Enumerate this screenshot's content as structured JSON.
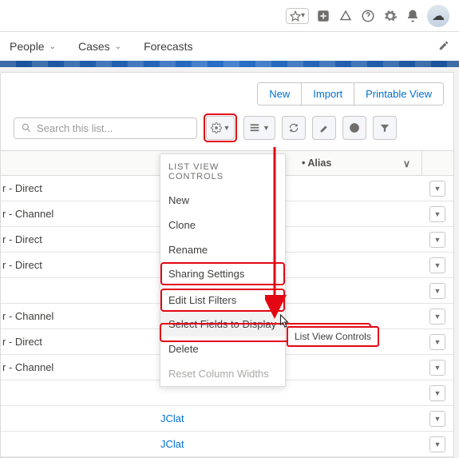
{
  "topbar": {
    "star_caret": "▾",
    "avatar": "☁"
  },
  "nav": {
    "people": "People",
    "cases": "Cases",
    "forecasts": "Forecasts"
  },
  "buttons": {
    "new": "New",
    "import": "Import",
    "printable": "Printable View"
  },
  "search": {
    "placeholder": "Search this list..."
  },
  "table": {
    "alias_header": "Alias",
    "chev": "∨"
  },
  "rows": [
    {
      "title": "r - Direct",
      "alias": ""
    },
    {
      "title": "r - Channel",
      "alias": ""
    },
    {
      "title": "r - Direct",
      "alias": ""
    },
    {
      "title": "r - Direct",
      "alias": ""
    },
    {
      "title": "",
      "alias": ""
    },
    {
      "title": "r - Channel",
      "alias": ""
    },
    {
      "title": "r - Direct",
      "alias": ""
    },
    {
      "title": "r - Channel",
      "alias": ""
    },
    {
      "title": "",
      "alias": ""
    },
    {
      "title": "",
      "alias": "JClat"
    },
    {
      "title": "",
      "alias": "JClat"
    }
  ],
  "menu": {
    "title": "LIST VIEW CONTROLS",
    "new": "New",
    "clone": "Clone",
    "rename": "Rename",
    "sharing": "Sharing Settings",
    "edit_filters": "Edit List Filters",
    "select_fields": "Select Fields to Display",
    "delete": "Delete",
    "reset": "Reset Column Widths"
  },
  "tooltip": "List View Controls"
}
